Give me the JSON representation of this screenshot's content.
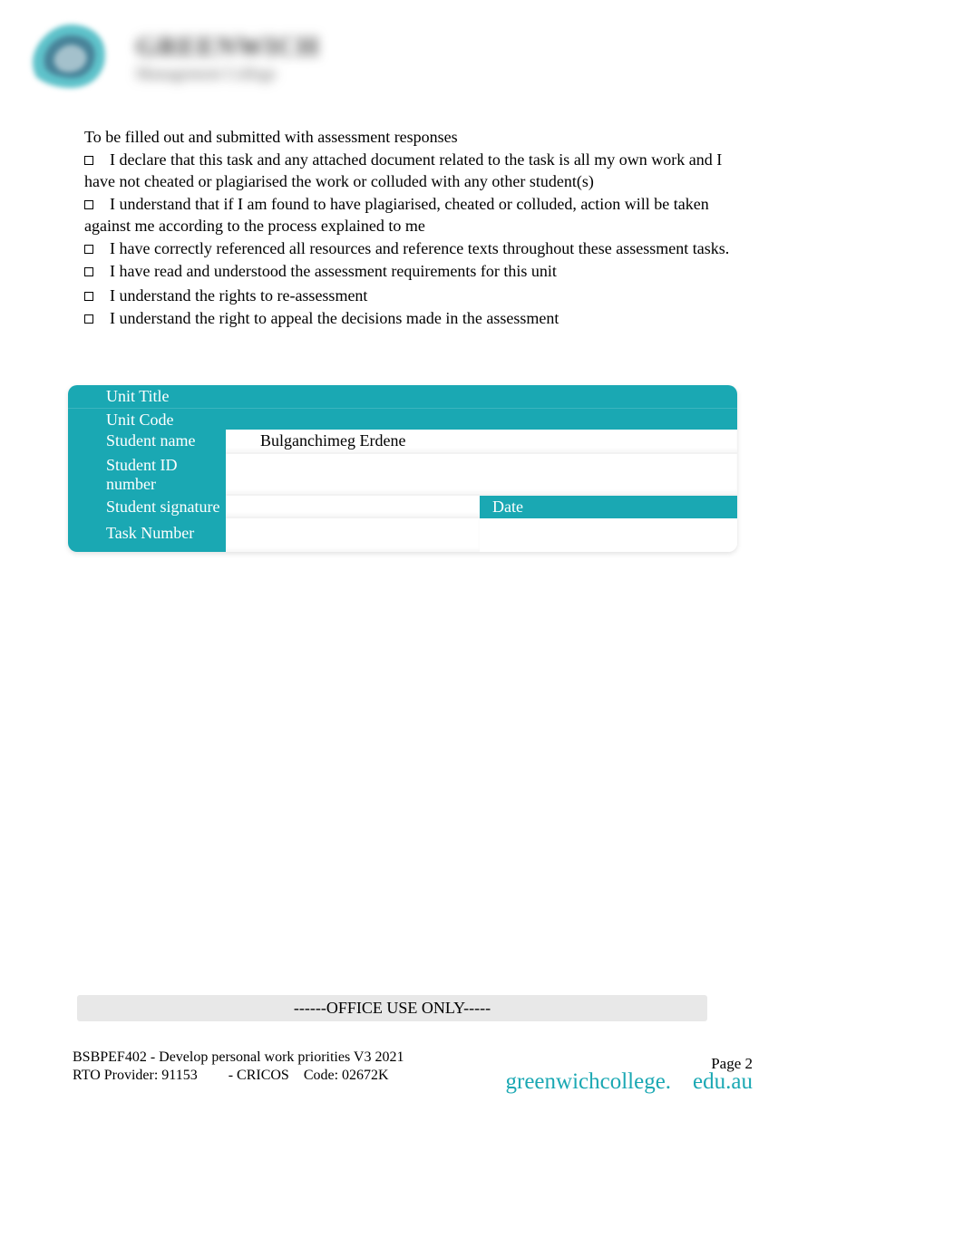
{
  "logo": {
    "main_text": "GREENWICH",
    "sub_text": "Management College"
  },
  "intro": "To be filled out and submitted with assessment responses",
  "declarations": [
    "I declare that this task and any attached document related to the task is all my own work and I have not cheated or plagiarised the work or colluded with any other student(s)",
    "I understand that if I am found to have plagiarised, cheated or colluded, action will be taken against me according to the process explained to me",
    "I have correctly referenced all resources and reference texts throughout these assessment tasks.",
    "I have read and understood the assessment requirements for this unit",
    "I understand the rights to re-assessment",
    "I understand the right to appeal the decisions made in the assessment"
  ],
  "form": {
    "labels": {
      "unit_title": "Unit Title",
      "unit_code": "Unit Code",
      "student_name": "Student name",
      "student_id": "Student ID number",
      "student_signature": "Student signature",
      "date": "Date",
      "task_number": "Task Number"
    },
    "values": {
      "unit_title": "",
      "unit_code": "",
      "student_name": "Bulganchimeg Erdene",
      "student_id": "",
      "student_signature": "",
      "date": "",
      "task_number": "",
      "task_number_extra": ""
    }
  },
  "office_use": "------OFFICE USE ONLY-----",
  "footer": {
    "line1": "BSBPEF402 - Develop personal work priorities V3 2021",
    "line2_part1": "RTO Provider: 91153",
    "line2_part2": "- CRICOS",
    "line2_part3": "Code: 02672K",
    "page": "Page 2",
    "url_part1": "greenwichcollege.",
    "url_part2": "edu.au"
  }
}
